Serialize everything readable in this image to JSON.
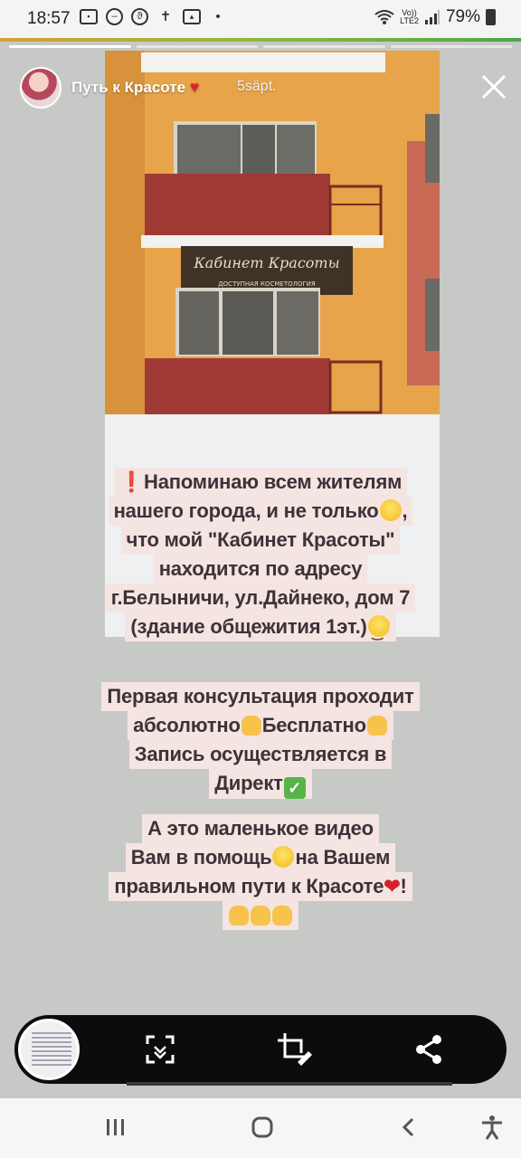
{
  "status_bar": {
    "time": "18:57",
    "battery": "79%",
    "network": "LTE2",
    "volte": "Vo))",
    "icons": [
      "tv-app-icon",
      "do-not-disturb-icon",
      "viber-icon",
      "accessibility-icon",
      "gallery-icon",
      "dot-icon",
      "wifi-icon",
      "signal-icon",
      "battery-icon"
    ]
  },
  "story": {
    "progress": [
      1.0,
      0.0,
      0.0,
      0.0
    ],
    "username": "Путь к Красоте",
    "username_emoji": "❤️",
    "time_ago": "5säpt."
  },
  "photo": {
    "sign_title": "Кабинет Красоты",
    "sign_subtitle": "ДОСТУПНАЯ КОСМЕТОЛОГИЯ"
  },
  "text_block_1": {
    "line1": "Напоминаю всем жителям",
    "line2": "нашего города, и не только",
    "line2_end": ",",
    "line3": "что мой \"Кабинет Красоты\"",
    "line4": "находится по адресу",
    "line5": "г.Белыничи, ул.Дайнеко, дом 7",
    "line6": "(здание общежития 1эт.)"
  },
  "text_block_2": {
    "line1": "Первая консультация проходит",
    "line2a": "абсолютно",
    "line2b": "Бесплатно",
    "line3": "Запись осуществляется в",
    "line4": "Директ"
  },
  "text_block_3": {
    "line1": "А это маленькое видео",
    "line2a": "Вам в помощь",
    "line2b": "на Вашем",
    "line3": "правильном пути к Красоте",
    "line3_end": "!"
  },
  "actions": [
    "scan-icon",
    "crop-edit-icon",
    "share-icon"
  ],
  "nav": [
    "recent-apps-button",
    "home-button",
    "back-button",
    "accessibility-button"
  ],
  "colors": {
    "text_bg": "#f4e4e2",
    "text": "#3d3237",
    "accent_red": "#d5202b",
    "action_bar": "#0c0c0c"
  }
}
